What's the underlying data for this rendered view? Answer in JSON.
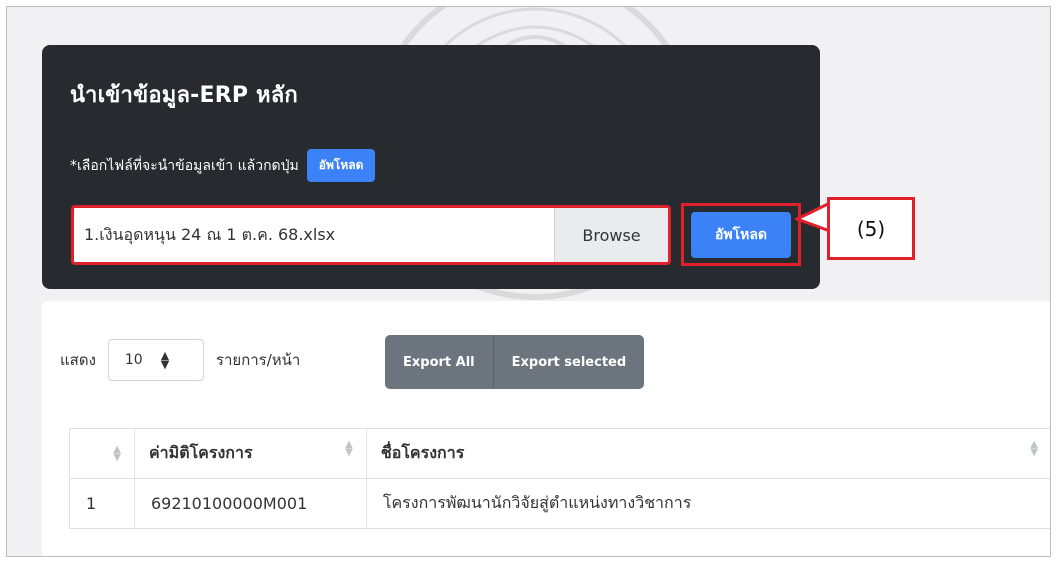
{
  "upload_card": {
    "title": "นำเข้าข้อมูล-ERP หลัก",
    "hint": "*เลือกไฟล์ที่จะนำข้อมูลเข้า แล้วกดปุ่ม",
    "hint_button": "อัพโหลด",
    "file_name": "1.เงินอุดหนุน 24 ณ 1 ต.ค. 68.xlsx",
    "browse_label": "Browse",
    "upload_label": "อัพโหลด"
  },
  "callout": {
    "label": "(5)"
  },
  "table_controls": {
    "show_label": "แสดง",
    "page_size": "10",
    "per_page_label": "รายการ/หน้า",
    "export_all": "Export All",
    "export_selected": "Export selected"
  },
  "table": {
    "headers": [
      "",
      "ค่ามิติโครงการ",
      "ชื่อโครงการ"
    ],
    "rows": [
      {
        "no": "1",
        "code": "69210100000M001",
        "name": "โครงการพัฒนานักวิจัยสู่ตำแหน่งทางวิชาการ"
      }
    ]
  },
  "colors": {
    "accent": "#3b82f6",
    "highlight": "#e0202a",
    "card_bg": "#272a2e"
  }
}
